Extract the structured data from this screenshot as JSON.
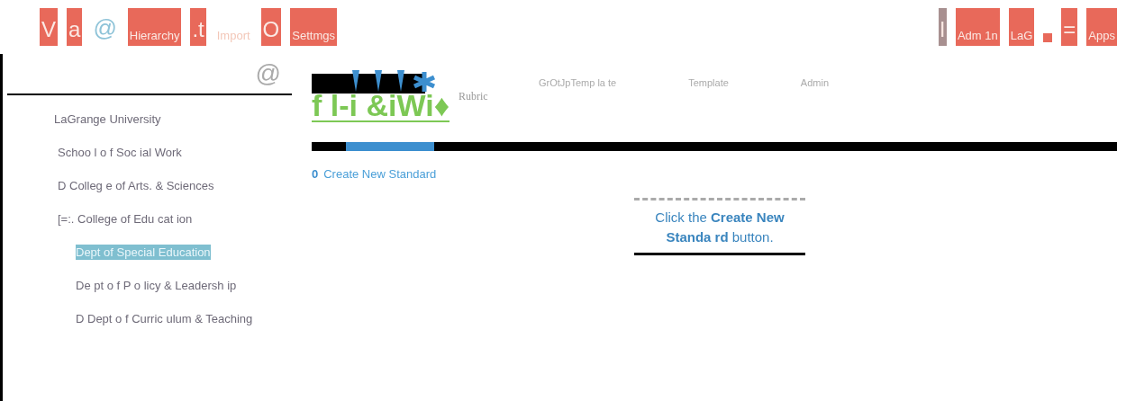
{
  "top_nav": {
    "left": [
      {
        "label": "V",
        "kind": "block"
      },
      {
        "label": "a",
        "kind": "block"
      },
      {
        "label": "@",
        "kind": "glyph"
      },
      {
        "label": "Hierarchy",
        "kind": "block"
      },
      {
        "label": ".t",
        "kind": "block"
      },
      {
        "label": "Import",
        "kind": "faded"
      },
      {
        "label": "O",
        "kind": "block"
      },
      {
        "label": "Settmgs",
        "kind": "block"
      }
    ],
    "right": [
      {
        "label": "l",
        "kind": "grey"
      },
      {
        "label": "Adm 1n",
        "kind": "block"
      },
      {
        "label": "LaG",
        "kind": "block"
      },
      {
        "kind": "square"
      },
      {
        "label": "=",
        "kind": "block"
      },
      {
        "label": "Apps",
        "kind": "block"
      }
    ]
  },
  "sidebar": {
    "icon": "@",
    "items": [
      {
        "label": "LaGrange University",
        "selected": false,
        "children": [
          {
            "label": "Schoo l o f Soc ial Work",
            "selected": false
          },
          {
            "label": "D Colleg e of Arts. & Sciences",
            "selected": false
          },
          {
            "label": "[=:. College of Edu cat ion",
            "selected": false,
            "children": [
              {
                "label": "Dept of Special Education",
                "selected": true
              },
              {
                "label": "De pt o f P o licy & Leadersh ip",
                "selected": false
              },
              {
                "label": "D Dept o f Curric ulum & Teaching",
                "selected": false
              }
            ]
          }
        ]
      }
    ]
  },
  "main": {
    "tabs": [
      {
        "label": "GrOtJpTemp la te",
        "selected": false
      },
      {
        "label": "Template",
        "selected": false
      },
      {
        "label": "Admin",
        "selected": false
      }
    ],
    "logo": "f l-i &iWi♦",
    "logo_caption": "Rubric",
    "scroll_track": {
      "level": 0.11
    },
    "create_link": {
      "icon": "0",
      "label": "Create New Standard"
    },
    "empty_message": "Click the **Create New Standa rd** button."
  }
}
